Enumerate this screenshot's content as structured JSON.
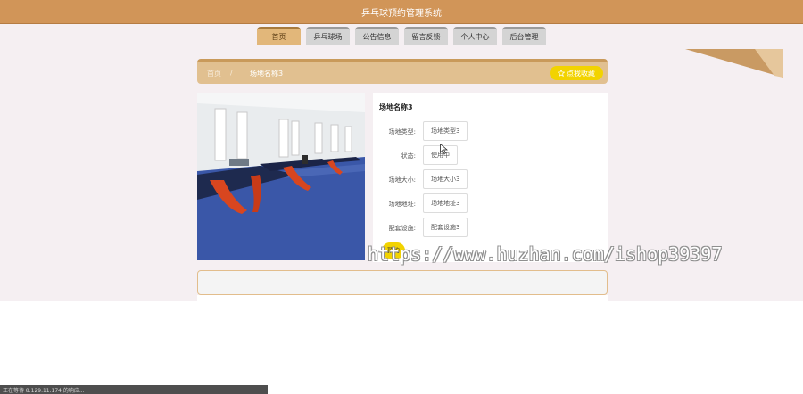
{
  "header": {
    "title": "乒乓球预约管理系统"
  },
  "nav": {
    "items": [
      {
        "label": "首页"
      },
      {
        "label": "乒乓球场"
      },
      {
        "label": "公告信息"
      },
      {
        "label": "留言反馈"
      },
      {
        "label": "个人中心"
      },
      {
        "label": "后台管理"
      }
    ]
  },
  "breadcrumb": {
    "home": "首页",
    "separator": "/",
    "current": "场地名称3"
  },
  "collect_button": {
    "icon": "star-icon",
    "label": "点我收藏"
  },
  "photo": {
    "subject": "ping-pong-hall-photo"
  },
  "detail": {
    "title": "场地名称3",
    "fields": [
      {
        "label": "场地类型:",
        "value": "场地类型3"
      },
      {
        "label": "状态:",
        "value": "使用中"
      },
      {
        "label": "场地大小:",
        "value": "场地大小3"
      },
      {
        "label": "场地地址:",
        "value": "场地地址3"
      },
      {
        "label": "配套设施:",
        "value": "配套设施3"
      }
    ],
    "book_button": "预约"
  },
  "watermark": "https://www.huzhan.com/ishop39397",
  "status_bar": "正在等待 8.129.11.174 的响应...",
  "colors": {
    "header": "#d19558",
    "nav_active": "#e2b77a",
    "accent_yellow": "#f2d300",
    "breadcrumb": "#e1c090"
  }
}
